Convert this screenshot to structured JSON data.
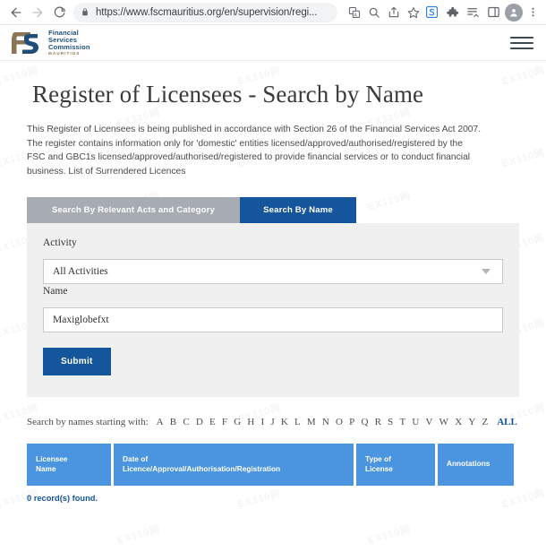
{
  "browser": {
    "back_icon": "back-arrow-icon",
    "forward_icon": "forward-arrow-icon",
    "reload_icon": "reload-icon",
    "lock_icon": "lock-icon",
    "url": "https://www.fscmauritius.org/en/supervision/regi...",
    "omnibox_actions": [
      {
        "name": "translate-icon",
        "label": "Translate"
      },
      {
        "name": "search-icon",
        "label": "Search"
      },
      {
        "name": "share-icon",
        "label": "Share"
      },
      {
        "name": "bookmark-star-icon",
        "label": "Bookmark"
      }
    ],
    "toolbar_actions": [
      {
        "name": "extension-s-icon",
        "label": "S"
      },
      {
        "name": "puzzle-extensions-icon",
        "label": "Extensions"
      },
      {
        "name": "reading-list-icon",
        "label": "Reading list"
      },
      {
        "name": "side-panel-icon",
        "label": "Side panel"
      },
      {
        "name": "profile-avatar-icon",
        "label": "Profile"
      },
      {
        "name": "kebab-menu-icon",
        "label": "Customize and control"
      }
    ]
  },
  "site": {
    "logo": {
      "line1": "Financial",
      "line2": "Services",
      "line3": "Commission",
      "subtitle": "MAURITIUS"
    },
    "menu_icon": "hamburger-menu-icon"
  },
  "main": {
    "title": "Register of Licensees - Search by Name",
    "intro": "This Register of Licensees is being published in accordance with Section 26 of the Financial Services Act 2007. The register contains information only for 'domestic' entities licensed/approved/authorised/registered by the FSC and GBC1s licensed/approved/authorised/registered to provide financial services or to conduct financial business. List of Surrendered Licences",
    "tabs": [
      {
        "label": "Search By Relevant Acts and Category",
        "active": false
      },
      {
        "label": "Search By Name",
        "active": true
      }
    ],
    "form": {
      "activity_label": "Activity",
      "activity_value": "All Activities",
      "activity_caret": "chevron-down-icon",
      "name_label": "Name",
      "name_value": "Maxiglobefxt",
      "name_placeholder": "",
      "submit_label": "Submit"
    },
    "alphabet": {
      "prefix_label": "Search by names starting with:",
      "letters": [
        "A",
        "B",
        "C",
        "D",
        "E",
        "F",
        "G",
        "H",
        "I",
        "J",
        "K",
        "L",
        "M",
        "N",
        "O",
        "P",
        "Q",
        "R",
        "S",
        "T",
        "U",
        "V",
        "W",
        "X",
        "Y",
        "Z"
      ],
      "all_label": "ALL"
    },
    "table": {
      "headers": [
        "Licensee\nName",
        "Date of\nLicence/Approval/Authorisation/Registration",
        "Type of\nLicense",
        "Annotations"
      ],
      "header_line1": [
        "Licensee",
        "Date of",
        "Type of",
        "Annotations"
      ],
      "header_line2": [
        "Name",
        "Licence/Approval/Authorisation/Registration",
        "License",
        ""
      ],
      "rows": []
    },
    "records_found": "0 record(s) found."
  },
  "colors": {
    "brand_blue": "#15559b",
    "table_header_blue": "#4a94e0",
    "tab_inactive_gray": "#a6acb2",
    "panel_gray": "#f0f0f0",
    "logo_navy": "#1f4e79",
    "logo_tan": "#8a7654"
  },
  "watermark_text": "EX110网"
}
